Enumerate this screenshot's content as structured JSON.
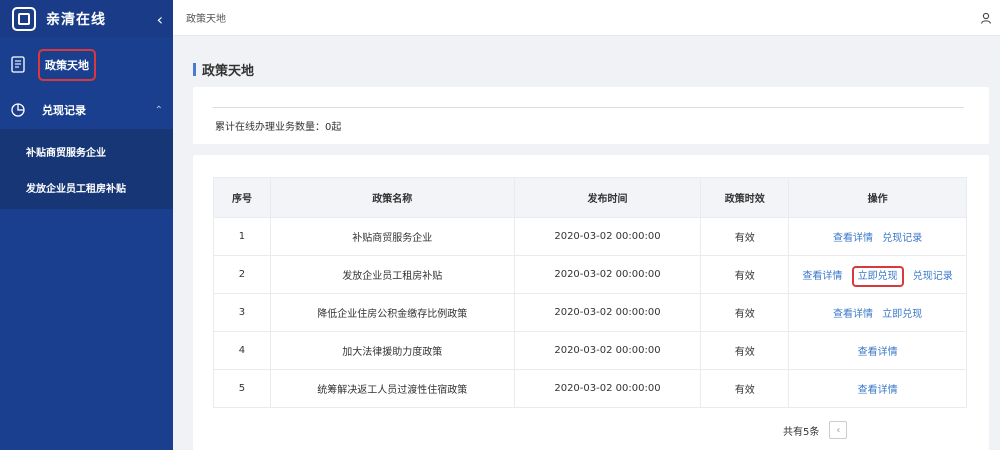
{
  "app": {
    "name": "亲清在线"
  },
  "sidebar": {
    "collapse_icon": "‹",
    "policy_label": "政策天地",
    "records_label": "兑现记录",
    "records_caret": "⌃",
    "sub_items": [
      {
        "label": "补贴商贸服务企业"
      },
      {
        "label": "发放企业员工租房补贴"
      }
    ]
  },
  "topbar": {
    "breadcrumb": "政策天地"
  },
  "page": {
    "title": "政策天地"
  },
  "stats": {
    "text": "累计在线办理业务数量：0起"
  },
  "table": {
    "headers": {
      "no": "序号",
      "name": "政策名称",
      "time": "发布时间",
      "status": "政策时效",
      "ops": "操作"
    },
    "rows": [
      {
        "no": "1",
        "name": "补贴商贸服务企业",
        "time": "2020-03-02 00:00:00",
        "status": "有效",
        "ops": [
          "查看详情",
          "兑现记录"
        ]
      },
      {
        "no": "2",
        "name": "发放企业员工租房补贴",
        "time": "2020-03-02 00:00:00",
        "status": "有效",
        "ops": [
          "查看详情",
          "立即兑现",
          "兑现记录"
        ]
      },
      {
        "no": "3",
        "name": "降低企业住房公积金缴存比例政策",
        "time": "2020-03-02 00:00:00",
        "status": "有效",
        "ops": [
          "查看详情",
          "立即兑现"
        ]
      },
      {
        "no": "4",
        "name": "加大法律援助力度政策",
        "time": "2020-03-02 00:00:00",
        "status": "有效",
        "ops": [
          "查看详情"
        ]
      },
      {
        "no": "5",
        "name": "统筹解决返工人员过渡性住宿政策",
        "time": "2020-03-02 00:00:00",
        "status": "有效",
        "ops": [
          "查看详情"
        ]
      }
    ]
  },
  "pager": {
    "total": "共有5条",
    "prev": "‹"
  },
  "colors": {
    "sidebar_bg": "#1b3f8f",
    "link": "#3a78c9",
    "highlight": "#d9383d"
  }
}
